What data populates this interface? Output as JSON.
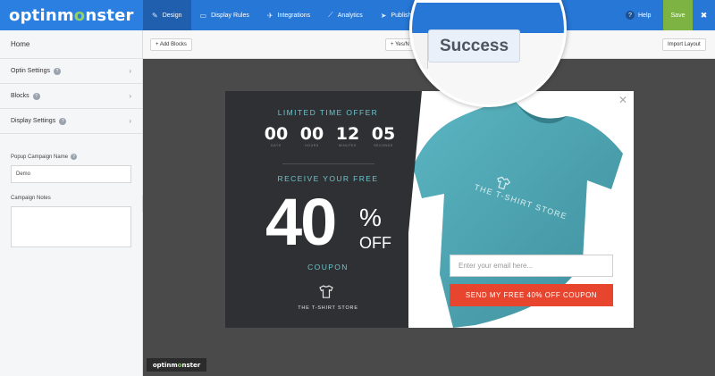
{
  "app": {
    "logo_prefix": "optinm",
    "logo_o": "o",
    "logo_suffix": "nster"
  },
  "nav": {
    "items": [
      {
        "label": "Design",
        "icon": "brush-icon",
        "active": true
      },
      {
        "label": "Display Rules",
        "icon": "monitor-icon",
        "active": false
      },
      {
        "label": "Integrations",
        "icon": "plane-icon",
        "active": false
      },
      {
        "label": "Analytics",
        "icon": "chart-icon",
        "active": false
      },
      {
        "label": "Publish",
        "icon": "send-icon",
        "active": false
      }
    ],
    "help_label": "Help",
    "save_label": "Save"
  },
  "sidebar": {
    "home": "Home",
    "sections": [
      {
        "label": "Optin Settings"
      },
      {
        "label": "Blocks"
      },
      {
        "label": "Display Settings"
      }
    ],
    "campaign_name_label": "Popup Campaign Name",
    "campaign_name_value": "Demo",
    "campaign_notes_label": "Campaign Notes",
    "campaign_notes_value": ""
  },
  "toolbar": {
    "add_blocks": "+ Add Blocks",
    "yes_no": "+ Yes/N",
    "import_layout": "Import Layout"
  },
  "magnifier": {
    "success_label": "Success"
  },
  "popup": {
    "limited_time": "LIMITED TIME OFFER",
    "timer": [
      {
        "value": "00",
        "unit": "DAYS"
      },
      {
        "value": "00",
        "unit": "HOURS"
      },
      {
        "value": "12",
        "unit": "MINUTES"
      },
      {
        "value": "05",
        "unit": "SECONDS"
      }
    ],
    "receive": "RECEIVE YOUR FREE",
    "amount": "40",
    "percent": "%",
    "off": "OFF",
    "coupon": "COUPON",
    "store": "THE T-SHIRT STORE",
    "shirt_print": "THE T-SHIRT STORE",
    "email_placeholder": "Enter your email here...",
    "cta": "SEND MY FREE 40% OFF COUPON"
  },
  "footer_badge": {
    "prefix": "optinm",
    "o": "o",
    "suffix": "nster"
  },
  "colors": {
    "nav_blue": "#2677d6",
    "save_green": "#7cb342",
    "popup_dark": "#2e3033",
    "teal_text": "#6cc6cd",
    "cta_red": "#e8452e",
    "shirt": "#4fa7b5"
  }
}
